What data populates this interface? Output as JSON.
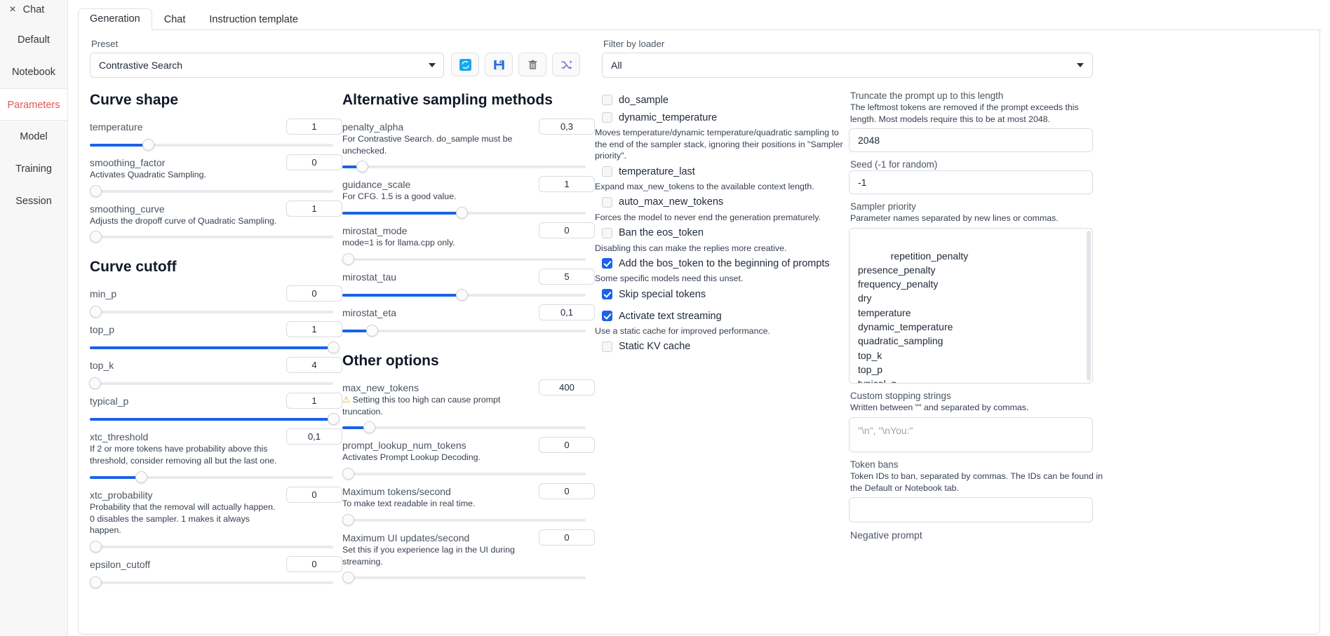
{
  "sidebar": {
    "close_icon": "×",
    "items": [
      {
        "label": "Chat",
        "active": false
      },
      {
        "label": "Default",
        "active": false
      },
      {
        "label": "Notebook",
        "active": false
      },
      {
        "label": "Parameters",
        "active": true
      },
      {
        "label": "Model",
        "active": false
      },
      {
        "label": "Training",
        "active": false
      },
      {
        "label": "Session",
        "active": false
      }
    ]
  },
  "tabs": [
    {
      "label": "Generation",
      "active": true
    },
    {
      "label": "Chat",
      "active": false
    },
    {
      "label": "Instruction template",
      "active": false
    }
  ],
  "preset": {
    "label": "Preset",
    "value": "Contrastive Search",
    "buttons": [
      {
        "name": "refresh-button",
        "icon": "⟳"
      },
      {
        "name": "save-button",
        "icon": "💾"
      },
      {
        "name": "delete-button",
        "icon": "🗑"
      },
      {
        "name": "neutralize-button",
        "icon": "🔀"
      }
    ]
  },
  "filter": {
    "label": "Filter by loader",
    "value": "All"
  },
  "curve_shape": {
    "title": "Curve shape",
    "params": [
      {
        "name": "temperature",
        "desc": "",
        "value": "1",
        "fill": 24,
        "thumb": 24
      },
      {
        "name": "smoothing_factor",
        "desc": "Activates Quadratic Sampling.",
        "value": "0",
        "fill": 0,
        "thumb": 0
      },
      {
        "name": "smoothing_curve",
        "desc": "Adjusts the dropoff curve of Quadratic Sampling.",
        "value": "1",
        "fill": 0,
        "thumb": 0
      }
    ]
  },
  "curve_cutoff": {
    "title": "Curve cutoff",
    "params": [
      {
        "name": "min_p",
        "desc": "",
        "value": "0",
        "fill": 0,
        "thumb": 0
      },
      {
        "name": "top_p",
        "desc": "",
        "value": "1",
        "fill": 100,
        "thumb": 100
      },
      {
        "name": "top_k",
        "desc": "",
        "value": "4",
        "fill": 2,
        "thumb": 2
      },
      {
        "name": "typical_p",
        "desc": "",
        "value": "1",
        "fill": 100,
        "thumb": 100
      },
      {
        "name": "xtc_threshold",
        "desc": "If 2 or more tokens have probability above this threshold, consider removing all but the last one.",
        "value": "0,1",
        "fill": 21,
        "thumb": 21
      },
      {
        "name": "xtc_probability",
        "desc": "Probability that the removal will actually happen. 0 disables the sampler. 1 makes it always happen.",
        "value": "0",
        "fill": 0,
        "thumb": 0
      },
      {
        "name": "epsilon_cutoff",
        "desc": "",
        "value": "0",
        "fill": 0,
        "thumb": 0
      }
    ]
  },
  "alt_sampling": {
    "title": "Alternative sampling methods",
    "params": [
      {
        "name": "penalty_alpha",
        "desc": "For Contrastive Search. do_sample must be unchecked.",
        "value": "0,3",
        "fill": 8,
        "thumb": 8
      },
      {
        "name": "guidance_scale",
        "desc": "For CFG. 1.5 is a good value.",
        "value": "1",
        "fill": 49,
        "thumb": 49
      },
      {
        "name": "mirostat_mode",
        "desc": "mode=1 is for llama.cpp only.",
        "value": "0",
        "fill": 0,
        "thumb": 0
      },
      {
        "name": "mirostat_tau",
        "desc": "",
        "value": "5",
        "fill": 49,
        "thumb": 49
      },
      {
        "name": "mirostat_eta",
        "desc": "",
        "value": "0,1",
        "fill": 12,
        "thumb": 12
      }
    ]
  },
  "other_options": {
    "title": "Other options",
    "params": [
      {
        "name": "max_new_tokens",
        "desc": "Setting this too high can cause prompt truncation.",
        "warn": true,
        "value": "400",
        "fill": 11,
        "thumb": 11
      },
      {
        "name": "prompt_lookup_num_tokens",
        "desc": "Activates Prompt Lookup Decoding.",
        "value": "0",
        "fill": 0,
        "thumb": 0
      },
      {
        "name": "Maximum tokens/second",
        "desc": "To make text readable in real time.",
        "value": "0",
        "fill": 0,
        "thumb": 0
      },
      {
        "name": "Maximum UI updates/second",
        "desc": "Set this if you experience lag in the UI during streaming.",
        "value": "0",
        "fill": 0,
        "thumb": 0
      }
    ]
  },
  "checkboxes": [
    {
      "label": "do_sample",
      "checked": false,
      "desc": ""
    },
    {
      "label": "dynamic_temperature",
      "checked": false,
      "desc": "Moves temperature/dynamic temperature/quadratic sampling to the end of the sampler stack, ignoring their positions in \"Sampler priority\"."
    },
    {
      "label": "temperature_last",
      "checked": false,
      "desc": "Expand max_new_tokens to the available context length."
    },
    {
      "label": "auto_max_new_tokens",
      "checked": false,
      "desc": "Forces the model to never end the generation prematurely."
    },
    {
      "label": "Ban the eos_token",
      "checked": false,
      "desc": "Disabling this can make the replies more creative."
    },
    {
      "label": "Add the bos_token to the beginning of prompts",
      "checked": true,
      "desc": "Some specific models need this unset."
    },
    {
      "label": "Skip special tokens",
      "checked": true,
      "desc": ""
    },
    {
      "label": "Activate text streaming",
      "checked": true,
      "desc": "Use a static cache for improved performance."
    },
    {
      "label": "Static KV cache",
      "checked": false,
      "desc": ""
    }
  ],
  "right": {
    "truncate": {
      "label": "Truncate the prompt up to this length",
      "desc": "The leftmost tokens are removed if the prompt exceeds this length. Most models require this to be at most 2048.",
      "value": "2048"
    },
    "seed": {
      "label": "Seed (-1 for random)",
      "value": "-1"
    },
    "sampler_priority": {
      "label": "Sampler priority",
      "desc": "Parameter names separated by new lines or commas.",
      "value": "repetition_penalty\npresence_penalty\nfrequency_penalty\ndry\ntemperature\ndynamic_temperature\nquadratic_sampling\ntop_k\ntop_p\ntypical_p\nepsilon_cutoff\neta_cutoff\ntfs"
    },
    "custom_stopping": {
      "label": "Custom stopping strings",
      "desc": "Written between \"\" and separated by commas.",
      "placeholder": "\"\\n\", \"\\nYou:\""
    },
    "token_bans": {
      "label": "Token bans",
      "desc": "Token IDs to ban, separated by commas. The IDs can be found in the Default or Notebook tab.",
      "value": ""
    },
    "negative_prompt": {
      "label": "Negative prompt"
    }
  },
  "colors": {
    "accent": "#1a62e8",
    "active_sidebar": "#e05656",
    "warn": "#e8a33d"
  }
}
